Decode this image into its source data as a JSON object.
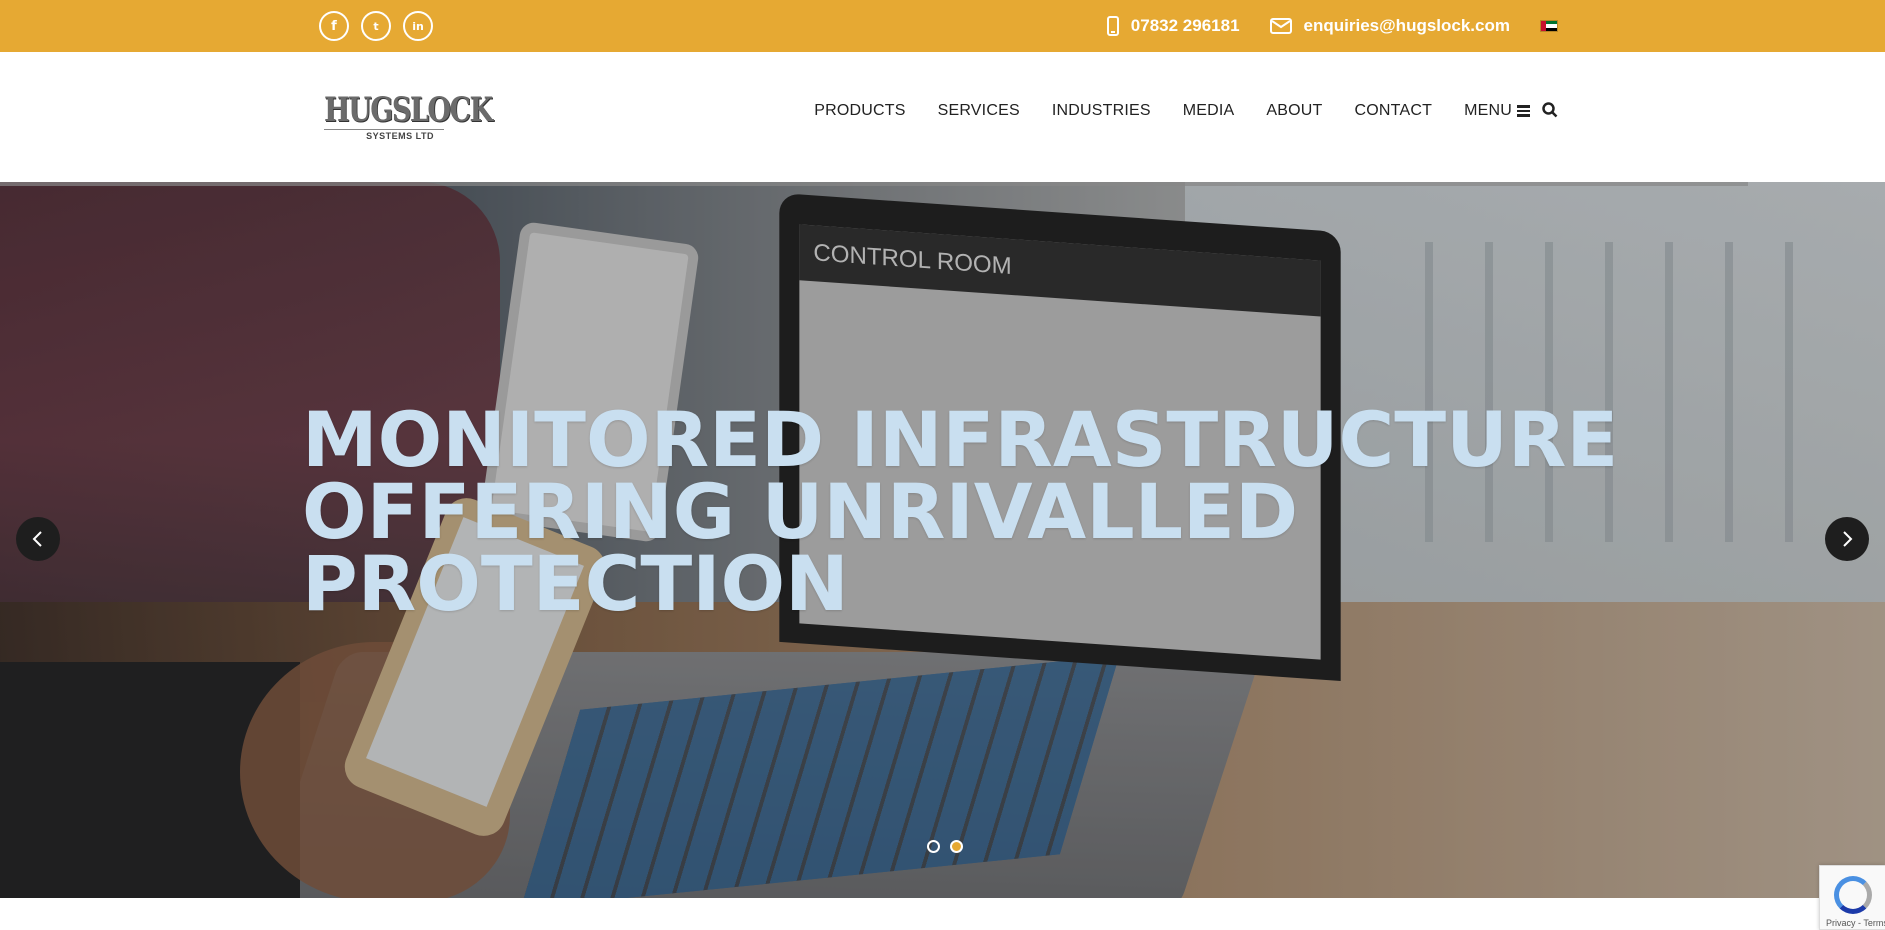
{
  "topbar": {
    "social": [
      {
        "name": "facebook",
        "glyph": "f"
      },
      {
        "name": "twitter",
        "glyph": "t"
      },
      {
        "name": "linkedin",
        "glyph": "in"
      }
    ],
    "phone": "07832 296181",
    "email": "enquiries@hugslock.com",
    "accent_color": "#e6a933"
  },
  "header": {
    "logo_main": "HUGSLOCK",
    "logo_sub": "SYSTEMS LTD",
    "nav": [
      "PRODUCTS",
      "SERVICES",
      "INDUSTRIES",
      "MEDIA",
      "ABOUT",
      "CONTACT"
    ],
    "menu_label": "MENU"
  },
  "hero": {
    "title_lines": [
      "MONITORED INFRASTRUCTURE",
      "OFFERING UNRIVALLED",
      "PROTECTION"
    ],
    "screen_title": "CONTROL ROOM",
    "slides": 2,
    "active_slide": 2
  },
  "recaptcha": {
    "text": "Privacy - Terms"
  }
}
